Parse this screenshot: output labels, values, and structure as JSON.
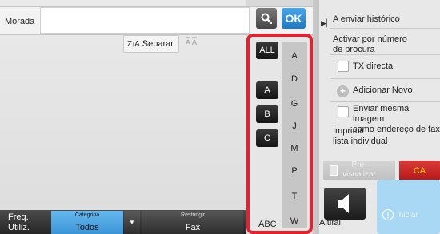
{
  "address": {
    "label": "Morada",
    "value": "",
    "ok_label": "OK"
  },
  "sort": {
    "label": "Separar",
    "icon_text": "Z↓A"
  },
  "index": {
    "all_label": "ALL",
    "buttons": [
      "A",
      "B",
      "C"
    ],
    "column_letters": [
      "A",
      "D",
      "G",
      "J",
      "M",
      "P",
      "T",
      "W"
    ],
    "abc_label": "ABC",
    "highlight_color": "#e4212f"
  },
  "bottom_bar": {
    "freq_line1": "Freq.",
    "freq_line2": "Utiliz.",
    "category_caption": "Categoria",
    "category_value": "Todos",
    "restrict_caption": "Restringir",
    "restrict_value": "Fax"
  },
  "side_panel": {
    "history": "A enviar histórico",
    "activate_line1": "Activar por número",
    "activate_line2": "de procura",
    "tx_direct": "TX directa",
    "add_new": "Adicionar Novo",
    "send_same_line1": "Enviar mesma imagem",
    "send_same_line2": "como endereço de fax",
    "print_line1": "Imprimir",
    "print_line2": "lista individual",
    "preview_line1": "Pré-",
    "preview_line2": "visualizar",
    "ca": "CA",
    "volume": "Altifal.",
    "start": "Iniciar"
  },
  "icons": [
    "search-icon",
    "sort-icon",
    "expand-icon",
    "add-icon",
    "speaker-icon",
    "start-icon"
  ]
}
